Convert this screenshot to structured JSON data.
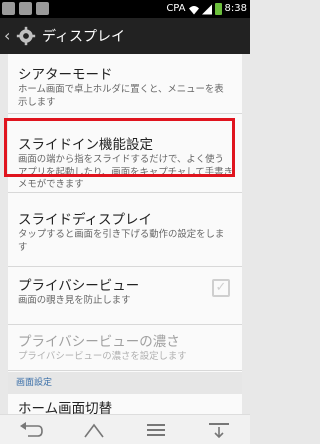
{
  "status_bar": {
    "carrier": "CPA",
    "time": "8:38"
  },
  "action_bar": {
    "title": "ディスプレイ"
  },
  "settings": {
    "theater_mode": {
      "title": "シアターモード",
      "summary": [
        "ホーム画面で卓上ホルダに置くと、メニューを表",
        "示します"
      ]
    },
    "slide_in": {
      "title": "スライドイン機能設定",
      "summary": [
        "画面の端から指をスライドするだけで、よく使う",
        "アプリを起動したり、画面をキャプチャして手書き",
        "メモができます"
      ]
    },
    "slide_display": {
      "title": "スライドディスプレイ",
      "summary": [
        "タップすると画面を引き下げる動作の設定をしま",
        "す"
      ]
    },
    "privacy_view": {
      "title": "プライバシービュー",
      "summary": "画面の覗き見を防止します",
      "checked": false
    },
    "privacy_density": {
      "title": "プライバシービューの濃さ",
      "summary": "プライバシービューの濃さを設定します"
    },
    "section_home": "画面設定",
    "home_switch": {
      "title": "ホーム画面切替"
    }
  },
  "navigation": {
    "back": "back-icon",
    "home": "home-icon",
    "menu": "menu-icon",
    "notifications": "notification-panel-icon"
  },
  "colors": {
    "highlight": "#e0141e",
    "section_header": "#3a6fa8"
  }
}
